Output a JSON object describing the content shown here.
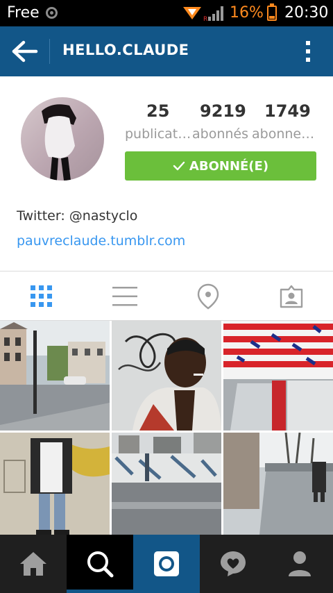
{
  "status_bar": {
    "carrier": "Free",
    "battery_percent": "16%",
    "time": "20:30"
  },
  "header": {
    "title": "HELLO.CLAUDE"
  },
  "profile": {
    "stats": [
      {
        "value": "25",
        "label": "publicat…"
      },
      {
        "value": "9219",
        "label": "abonnés"
      },
      {
        "value": "1749",
        "label": "abonne…"
      }
    ],
    "follow_button_label": "ABONNÉ(E)",
    "bio_line": "Twitter: @nastyclo",
    "website": "pauvreclaude.tumblr.com"
  },
  "colors": {
    "header": "#125688",
    "follow_button": "#6bbf3b",
    "link": "#3897f0",
    "tab_active": "#3897f0",
    "nav_background": "#1f1f1f",
    "nav_active": "#125688"
  },
  "tabs": [
    {
      "icon": "grid-icon",
      "active": true
    },
    {
      "icon": "list-icon",
      "active": false
    },
    {
      "icon": "location-pin-icon",
      "active": false
    },
    {
      "icon": "tagged-photos-icon",
      "active": false
    }
  ],
  "bottom_nav": [
    {
      "icon": "home-icon",
      "active": false
    },
    {
      "icon": "search-icon",
      "active": true
    },
    {
      "icon": "camera-icon",
      "active": false
    },
    {
      "icon": "activity-heart-icon",
      "active": false
    },
    {
      "icon": "profile-icon",
      "active": false
    }
  ],
  "photos": [
    {
      "name": "street-houses-photo"
    },
    {
      "name": "selfie-graffiti-photo"
    },
    {
      "name": "flag-ceiling-photo"
    },
    {
      "name": "person-wall-photo"
    },
    {
      "name": "mural-street-photo"
    },
    {
      "name": "sidewalk-walker-photo"
    }
  ]
}
